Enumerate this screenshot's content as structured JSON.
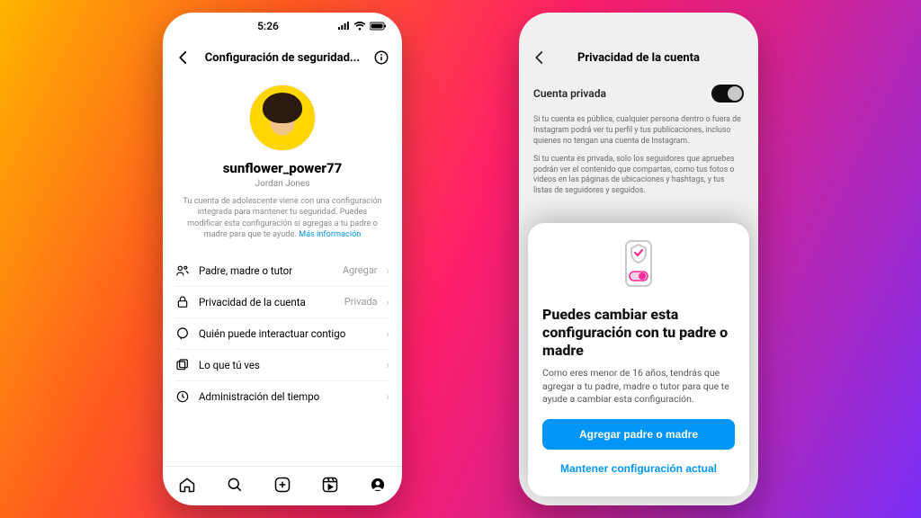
{
  "status": {
    "time": "5:26"
  },
  "phone1": {
    "header_title": "Configuración de seguridad...",
    "username": "sunflower_power77",
    "display_name": "Jordan Jones",
    "blurb": "Tu cuenta de adolescente viene con una configuración integrada para mantener tu seguridad. Puedes modificar esta configuración si agregas a tu padre o madre para que te ayude.",
    "blurb_link": "Más información",
    "menu": [
      {
        "label": "Padre, madre o tutor",
        "value": "Agregar"
      },
      {
        "label": "Privacidad de la cuenta",
        "value": "Privada"
      },
      {
        "label": "Quién puede interactuar contigo",
        "value": ""
      },
      {
        "label": "Lo que tú ves",
        "value": ""
      },
      {
        "label": "Administración del tiempo",
        "value": ""
      }
    ]
  },
  "phone2": {
    "header_title": "Privacidad de la cuenta",
    "toggle_label": "Cuenta privada",
    "para1": "Si tu cuenta es pública, cualquier persona dentro o fuera de Instagram podrá ver tu perfil y tus publicaciones, incluso quienes no tengan una cuenta de Instagram.",
    "para2": "Si tu cuenta es privada, solo los seguidores que apruebes podrán ver el contenido que compartas, como tus fotos o videos en las páginas de ubicaciones y hashtags, y tus listas de seguidores y seguidos.",
    "sheet": {
      "title": "Puedes cambiar esta configuración con tu padre o madre",
      "body": "Como eres menor de 16 años, tendrás que agregar a tu padre, madre o tutor para que te ayude a cambiar esta configuración.",
      "primary": "Agregar padre o madre",
      "secondary": "Mantener configuración actual"
    }
  }
}
